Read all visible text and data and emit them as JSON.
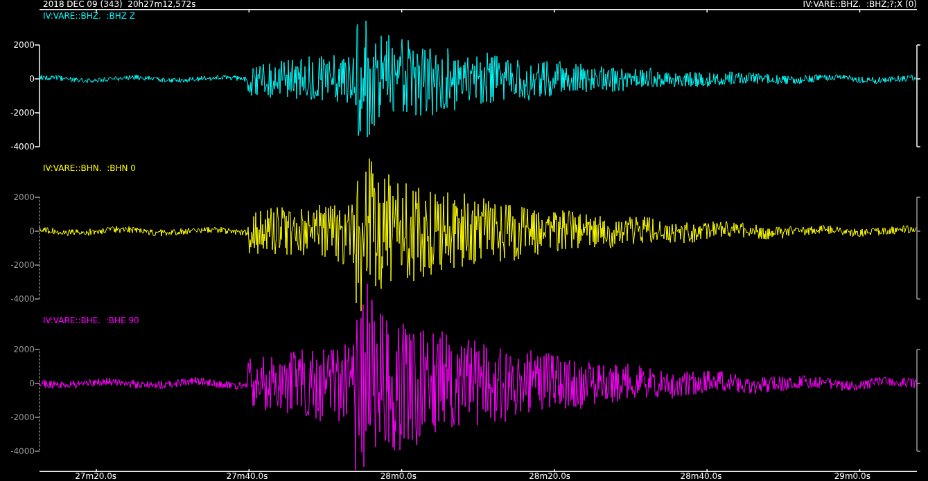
{
  "header": {
    "date_time": "2018 DEC 09 (343)  20h27m12,572s",
    "channel_info": "IV:VARE::BHZ.  :BHZ;?;X (0)"
  },
  "traces": [
    {
      "label": "IV:VARE::BHZ.  :BHZ Z",
      "color": "#00ffff",
      "selected": true,
      "yticks": [
        "2000",
        "0",
        "-2000",
        "-4000"
      ]
    },
    {
      "label": "IV:VARE::BHN.  :BHN 0",
      "color": "#ffff00",
      "selected": false,
      "yticks": [
        "2000",
        "0",
        "-2000",
        "-4000"
      ]
    },
    {
      "label": "IV:VARE::BHE.  :BHE 90",
      "color": "#ff00ff",
      "selected": false,
      "yticks": [
        "2000",
        "0",
        "-2000",
        "-4000"
      ]
    }
  ],
  "time_axis": {
    "ticks": [
      "27m20.0s",
      "27m40.0s",
      "28m0.0s",
      "28m20.0s",
      "28m40.0s",
      "29m0.0s"
    ]
  }
}
